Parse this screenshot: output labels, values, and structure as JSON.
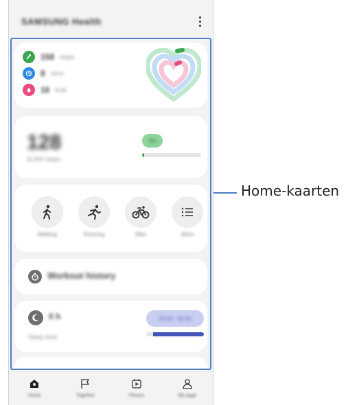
{
  "app": {
    "title": "SAMSUNG Health",
    "more_icon": "more-vertical-icon"
  },
  "metrics": [
    {
      "icon": "steps-icon",
      "color": "#3aa64d",
      "value": "158",
      "unit": "steps"
    },
    {
      "icon": "clock-icon",
      "color": "#2d8ae3",
      "value": "8",
      "unit": "mins"
    },
    {
      "icon": "flame-icon",
      "color": "#e84a82",
      "value": "16",
      "unit": "kcal"
    }
  ],
  "steps_card": {
    "count": "128",
    "goal": "/6,000 steps",
    "badge": "2%",
    "progress_percent": 2,
    "accent": "#3aa64d"
  },
  "exercise_card": {
    "items": [
      {
        "label": "Walking",
        "icon": "walking-icon"
      },
      {
        "label": "Running",
        "icon": "running-icon"
      },
      {
        "label": "Bike",
        "icon": "bike-icon"
      },
      {
        "label": "More",
        "icon": "list-icon"
      }
    ]
  },
  "history_card": {
    "label": "Workout history",
    "icon": "stopwatch-icon"
  },
  "sleep_card": {
    "icon": "moon-icon",
    "value": "0 h",
    "subtitle": "Sleep time",
    "badge": "00:00 - 00:00",
    "accent": "#4356b8"
  },
  "bottom_nav": [
    {
      "label": "Home",
      "icon": "home-icon"
    },
    {
      "label": "Together",
      "icon": "flag-icon"
    },
    {
      "label": "Fitness",
      "icon": "fitness-icon"
    },
    {
      "label": "My page",
      "icon": "profile-icon"
    }
  ],
  "callout": {
    "label": "Home-kaarten",
    "color": "#4b7fbf"
  }
}
